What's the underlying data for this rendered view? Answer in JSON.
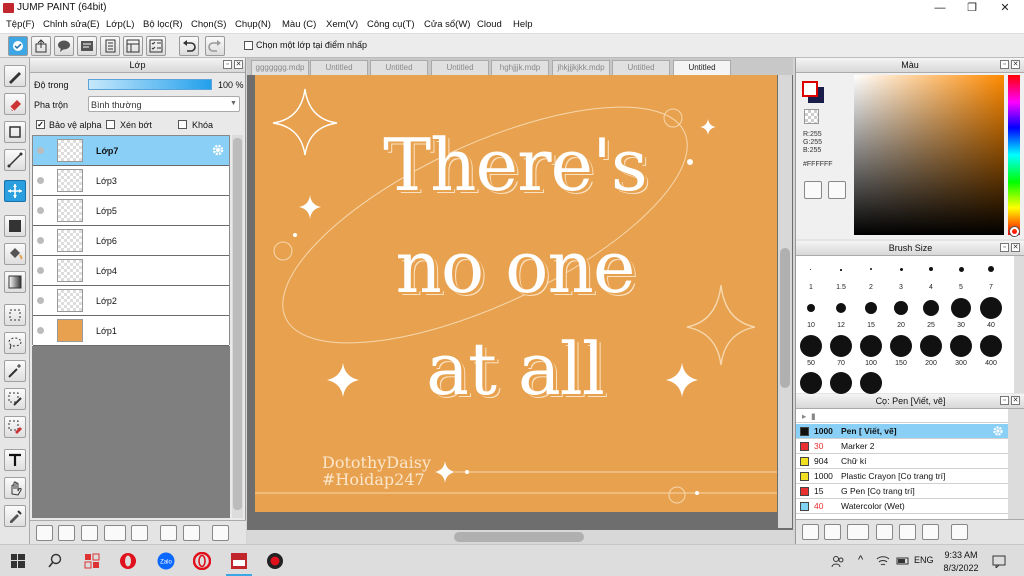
{
  "window": {
    "title": "JUMP PAINT (64bit)",
    "controls": [
      "—",
      "❐",
      "✕"
    ]
  },
  "menu": [
    "Tệp(F)",
    "Chỉnh sửa(E)",
    "Lớp(L)",
    "Bộ lọc(R)",
    "Chọn(S)",
    "Chụp(N)",
    "Màu (C)",
    "Xem(V)",
    "Công cụ(T)",
    "Cửa sổ(W)",
    "Cloud",
    "Help"
  ],
  "toolbar": {
    "checkbox_label": "Chọn một lớp tại điểm nhấp"
  },
  "layer_panel": {
    "title": "Lớp",
    "opacity_label": "Độ trong",
    "opacity_value": "100 %",
    "opacity_fraction": 1.0,
    "blend_label": "Pha trộn",
    "blend_value": "Bình thường",
    "protect_alpha": "Bảo vệ alpha",
    "clipping": "Xén bớt",
    "lock": "Khóa",
    "layers": [
      {
        "name": "Lớp7",
        "selected": true
      },
      {
        "name": "Lớp3",
        "selected": false
      },
      {
        "name": "Lớp5",
        "selected": false
      },
      {
        "name": "Lớp6",
        "selected": false
      },
      {
        "name": "Lớp4",
        "selected": false
      },
      {
        "name": "Lớp2",
        "selected": false
      },
      {
        "name": "Lớp1",
        "selected": false,
        "fill": "#e8a24f"
      }
    ]
  },
  "tabs": [
    "ggggggg.mdp",
    "Untitled",
    "Untitled",
    "Untitled",
    "hghjjjk.mdp",
    "jhkjjjkjkk.mdp",
    "Untitled",
    "Untitled"
  ],
  "artwork": {
    "line1": "There's",
    "line2": "no one",
    "line3": "at all",
    "signature1": "DotothyDaisy",
    "signature2": "#Hoidap247",
    "background": "#e8a24f"
  },
  "color_panel": {
    "title": "Màu",
    "r": "R:255",
    "g": "G:255",
    "b": "B:255",
    "hex": "#FFFFFF"
  },
  "brush_panel": {
    "title": "Brush Size",
    "sizes": [
      "1",
      "1.5",
      "2",
      "3",
      "4",
      "5",
      "7",
      "10",
      "12",
      "15",
      "20",
      "25",
      "30",
      "40",
      "50",
      "70",
      "100",
      "150",
      "200",
      "300",
      "400"
    ]
  },
  "tool_panel": {
    "title": "Cọ: Pen [Viết, vẽ]",
    "items": [
      {
        "num": "1000",
        "name": "Pen [ Viết, vẽ]",
        "color": "#111111",
        "selected": true
      },
      {
        "num": "30",
        "name": "Marker 2",
        "color": "#e83030",
        "selected": false
      },
      {
        "num": "904",
        "name": "Chữ kí",
        "color": "#f0e020",
        "selected": false
      },
      {
        "num": "1000",
        "name": "Plastic Crayon [Cọ trang trí]",
        "color": "#f0e020",
        "selected": false
      },
      {
        "num": "15",
        "name": "G Pen [Cọ trang trí]",
        "color": "#e83030",
        "selected": false
      },
      {
        "num": "40",
        "name": "Watercolor (Wet)",
        "color": "#7fd4f4",
        "selected": false
      }
    ]
  },
  "taskbar": {
    "lang": "ENG",
    "time": "9:33 AM",
    "date": "8/3/2022"
  }
}
